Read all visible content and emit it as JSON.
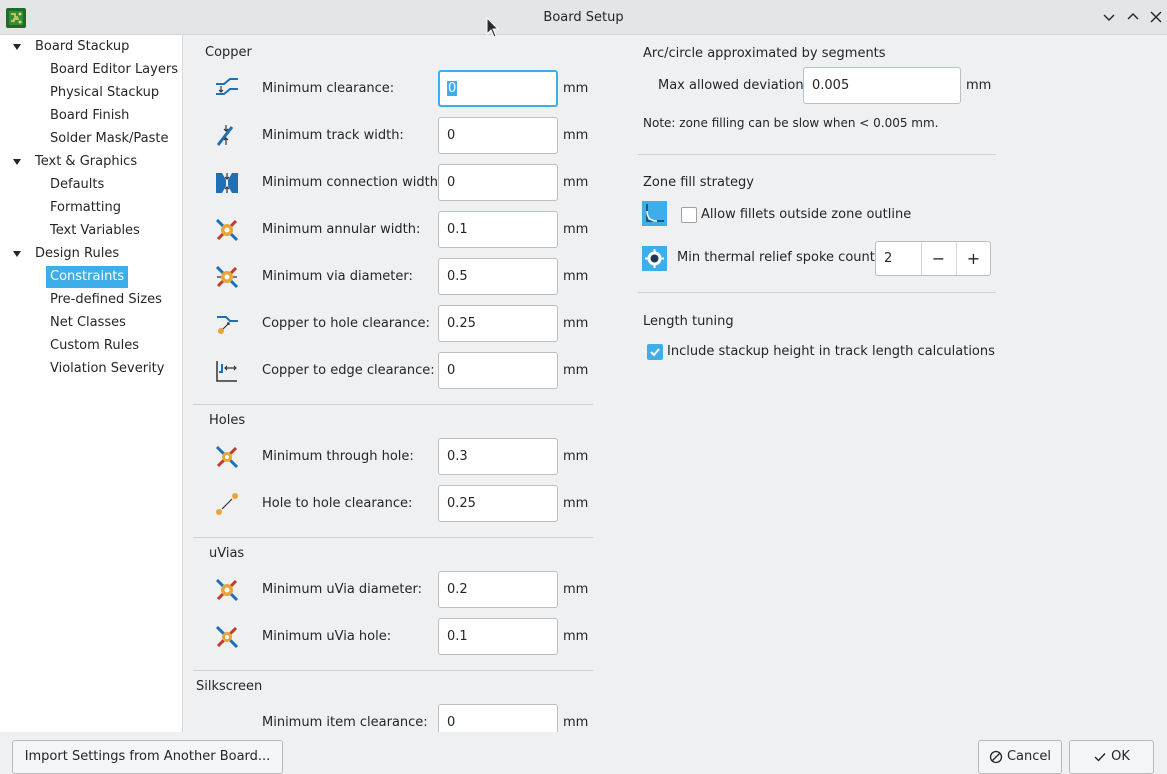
{
  "window": {
    "title": "Board Setup"
  },
  "tree": [
    {
      "label": "Board Stackup",
      "level": 0,
      "expanded": true
    },
    {
      "label": "Board Editor Layers",
      "level": 1
    },
    {
      "label": "Physical Stackup",
      "level": 1
    },
    {
      "label": "Board Finish",
      "level": 1
    },
    {
      "label": "Solder Mask/Paste",
      "level": 1
    },
    {
      "label": "Text & Graphics",
      "level": 0,
      "expanded": true
    },
    {
      "label": "Defaults",
      "level": 1
    },
    {
      "label": "Formatting",
      "level": 1
    },
    {
      "label": "Text Variables",
      "level": 1
    },
    {
      "label": "Design Rules",
      "level": 0,
      "expanded": true
    },
    {
      "label": "Constraints",
      "level": 1,
      "selected": true
    },
    {
      "label": "Pre-defined Sizes",
      "level": 1
    },
    {
      "label": "Net Classes",
      "level": 1
    },
    {
      "label": "Custom Rules",
      "level": 1
    },
    {
      "label": "Violation Severity",
      "level": 1
    }
  ],
  "copper": {
    "title": "Copper",
    "rows": [
      {
        "label": "Minimum clearance:",
        "value": "0",
        "unit": "mm",
        "icon": "clearance-icon"
      },
      {
        "label": "Minimum track width:",
        "value": "0",
        "unit": "mm",
        "icon": "track-width-icon"
      },
      {
        "label": "Minimum connection width:",
        "value": "0",
        "unit": "mm",
        "icon": "connection-width-icon"
      },
      {
        "label": "Minimum annular width:",
        "value": "0.1",
        "unit": "mm",
        "icon": "annular-width-icon"
      },
      {
        "label": "Minimum via diameter:",
        "value": "0.5",
        "unit": "mm",
        "icon": "via-diameter-icon"
      },
      {
        "label": "Copper to hole clearance:",
        "value": "0.25",
        "unit": "mm",
        "icon": "hole-clearance-icon"
      },
      {
        "label": "Copper to edge clearance:",
        "value": "0",
        "unit": "mm",
        "icon": "edge-clearance-icon"
      }
    ]
  },
  "holes": {
    "title": "Holes",
    "rows": [
      {
        "label": "Minimum through hole:",
        "value": "0.3",
        "unit": "mm",
        "icon": "through-hole-icon"
      },
      {
        "label": "Hole to hole clearance:",
        "value": "0.25",
        "unit": "mm",
        "icon": "hole-to-hole-icon"
      }
    ]
  },
  "uvias": {
    "title": "uVias",
    "rows": [
      {
        "label": "Minimum uVia diameter:",
        "value": "0.2",
        "unit": "mm",
        "icon": "uvia-diameter-icon"
      },
      {
        "label": "Minimum uVia hole:",
        "value": "0.1",
        "unit": "mm",
        "icon": "uvia-hole-icon"
      }
    ]
  },
  "silkscreen": {
    "title": "Silkscreen",
    "rows": [
      {
        "label": "Minimum item clearance:",
        "value": "0",
        "unit": "mm"
      }
    ]
  },
  "arc": {
    "title": "Arc/circle approximated by segments",
    "deviation_label": "Max allowed deviation:",
    "deviation_value": "0.005",
    "deviation_unit": "mm",
    "note": "Note: zone filling can be slow when < 0.005 mm."
  },
  "zone": {
    "title": "Zone fill strategy",
    "fillets_label": "Allow fillets outside zone outline",
    "fillets_checked": false,
    "spoke_label": "Min thermal relief spoke count:",
    "spoke_value": "2",
    "minus": "−",
    "plus": "+"
  },
  "length": {
    "title": "Length tuning",
    "stackup_label": "Include stackup height in track length calculations",
    "stackup_checked": true
  },
  "buttons": {
    "import": "Import Settings from Another Board...",
    "cancel": "Cancel",
    "ok": "OK"
  },
  "colors": {
    "accent": "#3daee9",
    "background": "#eff0f1"
  }
}
